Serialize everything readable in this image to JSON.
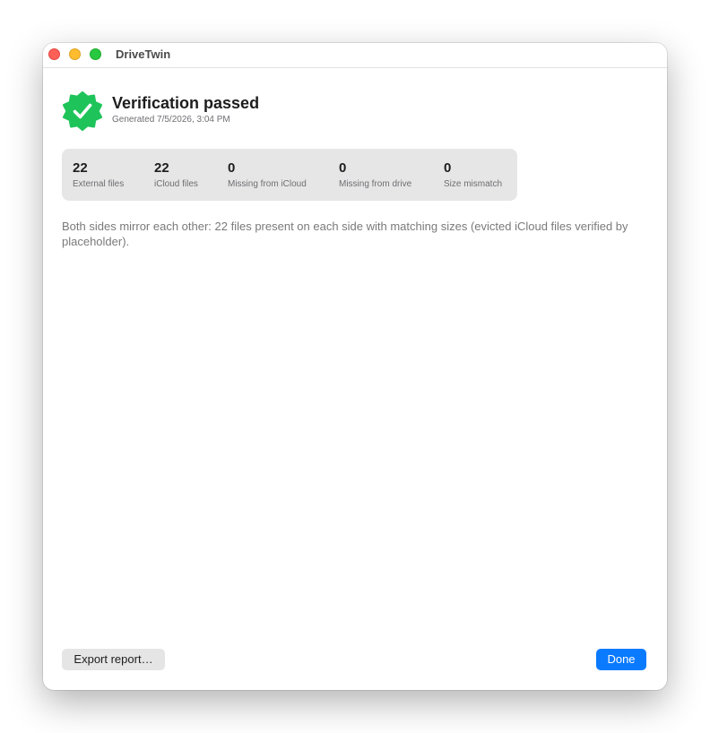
{
  "window": {
    "title": "DriveTwin"
  },
  "header": {
    "icon": "verified-checkmark-badge-icon",
    "title": "Verification passed",
    "subtitle": "Generated 7/5/2026, 3:04 PM"
  },
  "stats": [
    {
      "value": "22",
      "label": "External files"
    },
    {
      "value": "22",
      "label": "iCloud files"
    },
    {
      "value": "0",
      "label": "Missing from iCloud"
    },
    {
      "value": "0",
      "label": "Missing from drive"
    },
    {
      "value": "0",
      "label": "Size mismatch"
    }
  ],
  "summary": "Both sides mirror each other: 22 files present on each side with matching sizes (evicted iCloud files verified by placeholder).",
  "buttons": {
    "export_label": "Export report…",
    "done_label": "Done"
  },
  "colors": {
    "accent": "#0a7aff",
    "success": "#1ec45a",
    "stats_background": "#e6e6e6"
  }
}
